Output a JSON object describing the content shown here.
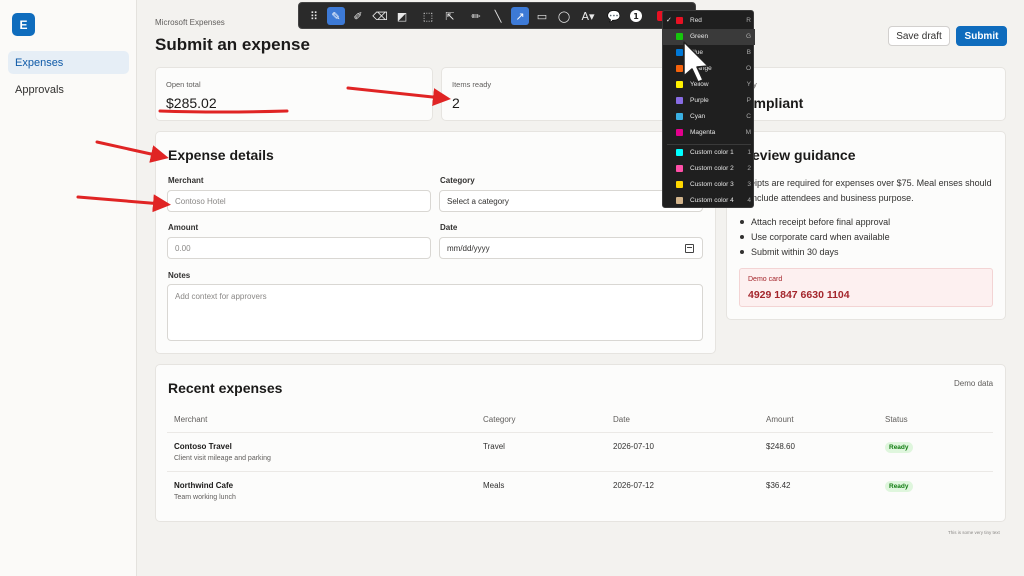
{
  "sidebar": {
    "logo_letter": "E",
    "items": [
      {
        "label": "Expenses"
      },
      {
        "label": "Approvals"
      }
    ]
  },
  "header": {
    "breadcrumb": "Microsoft Expenses",
    "title": "Submit an expense",
    "save_draft": "Save draft",
    "submit": "Submit"
  },
  "stats": [
    {
      "label": "Open total",
      "value": "$285.02"
    },
    {
      "label": "Items ready",
      "value": "2"
    },
    {
      "label": "y",
      "value": "ompliant"
    }
  ],
  "form": {
    "title": "Expense details",
    "merchant_label": "Merchant",
    "merchant_placeholder": "Contoso Hotel",
    "category_label": "Category",
    "category_value": "Select a category",
    "amount_label": "Amount",
    "amount_placeholder": "0.00",
    "date_label": "Date",
    "date_placeholder": "mm/dd/yyyy",
    "notes_label": "Notes",
    "notes_placeholder": "Add context for approvers"
  },
  "guidance": {
    "title": "eview guidance",
    "text": "eipts are required for expenses over $75. Meal enses should include attendees and business purpose.",
    "items": [
      "Attach receipt before final approval",
      "Use corporate card when available",
      "Submit within 30 days"
    ],
    "demo_card_label": "Demo card",
    "demo_card_number": "4929 1847 6630 1104"
  },
  "recent": {
    "title": "Recent expenses",
    "demo_note": "Demo data",
    "columns": [
      "Merchant",
      "Category",
      "Date",
      "Amount",
      "Status"
    ],
    "rows": [
      {
        "merchant": "Contoso Travel",
        "desc": "Client visit mileage and parking",
        "category": "Travel",
        "date": "2026-07-10",
        "amount": "$248.60",
        "status": "Ready"
      },
      {
        "merchant": "Northwind Cafe",
        "desc": "Team working lunch",
        "category": "Meals",
        "date": "2026-07-12",
        "amount": "$36.42",
        "status": "Ready"
      }
    ]
  },
  "footer_note": "This is some very tiny text",
  "toolbar": {
    "step_number": "1"
  },
  "color_menu": {
    "items": [
      {
        "name": "Red",
        "key": "R",
        "color": "#e81123"
      },
      {
        "name": "Green",
        "key": "G",
        "color": "#16c60c"
      },
      {
        "name": "Blue",
        "key": "B",
        "color": "#0078d7"
      },
      {
        "name": "Orange",
        "key": "O",
        "color": "#f7630c"
      },
      {
        "name": "Yellow",
        "key": "Y",
        "color": "#fff100"
      },
      {
        "name": "Purple",
        "key": "P",
        "color": "#886ce4"
      },
      {
        "name": "Cyan",
        "key": "C",
        "color": "#3ab0e2"
      },
      {
        "name": "Magenta",
        "key": "M",
        "color": "#e3008c"
      },
      {
        "name": "Custom color 1",
        "key": "1",
        "color": "#00ffff"
      },
      {
        "name": "Custom color 2",
        "key": "2",
        "color": "#ff4fa8"
      },
      {
        "name": "Custom color 3",
        "key": "3",
        "color": "#ffd800"
      },
      {
        "name": "Custom color 4",
        "key": "4",
        "color": "#d2b48c"
      }
    ]
  },
  "colors": {
    "accent": "#0f6cbd",
    "annotation": "#e02424"
  }
}
